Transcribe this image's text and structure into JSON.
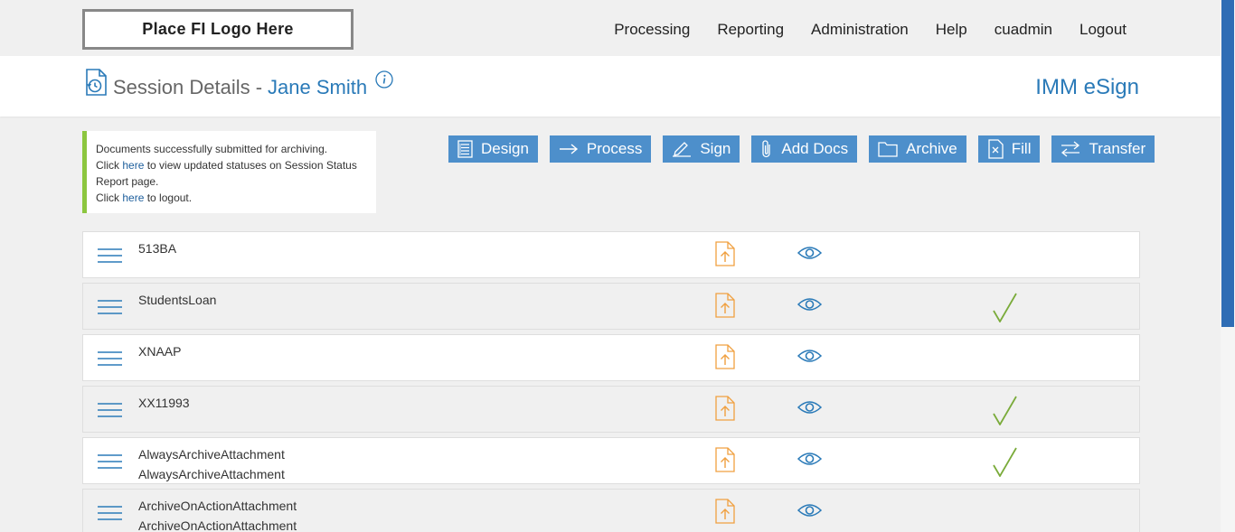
{
  "header": {
    "logo_text": "Place FI Logo Here",
    "nav": [
      "Processing",
      "Reporting",
      "Administration",
      "Help",
      "cuadmin",
      "Logout"
    ]
  },
  "title": {
    "prefix": "Session Details -",
    "name": "Jane Smith",
    "product": "IMM eSign"
  },
  "message": {
    "line1": "Documents successfully submitted for archiving.",
    "line2_pre": "Click ",
    "line2_link": "here",
    "line2_post": " to view updated statuses on Session Status Report page.",
    "line3_pre": "Click ",
    "line3_link": "here",
    "line3_post": " to logout."
  },
  "actions": [
    {
      "label": "Design",
      "icon": "list-icon"
    },
    {
      "label": "Process",
      "icon": "arrow-right-icon"
    },
    {
      "label": "Sign",
      "icon": "pen-icon"
    },
    {
      "label": "Add Docs",
      "icon": "paperclip-icon"
    },
    {
      "label": "Archive",
      "icon": "folder-icon"
    },
    {
      "label": "Fill",
      "icon": "document-x-icon"
    },
    {
      "label": "Transfer",
      "icon": "transfer-icon"
    }
  ],
  "documents": [
    {
      "lines": [
        "513BA"
      ],
      "archived": false
    },
    {
      "lines": [
        "StudentsLoan"
      ],
      "archived": true
    },
    {
      "lines": [
        "XNAAP"
      ],
      "archived": false
    },
    {
      "lines": [
        "XX11993"
      ],
      "archived": true
    },
    {
      "lines": [
        "AlwaysArchiveAttachment",
        "AlwaysArchiveAttachment"
      ],
      "archived": true
    },
    {
      "lines": [
        "ArchiveOnActionAttachment",
        "ArchiveOnActionAttachment"
      ],
      "archived": false
    }
  ],
  "colors": {
    "accent": "#2a7ab8",
    "button": "#4d8fcb",
    "upload_icon": "#f0a040",
    "check": "#7aab3a",
    "success_bar": "#8cc63f"
  }
}
